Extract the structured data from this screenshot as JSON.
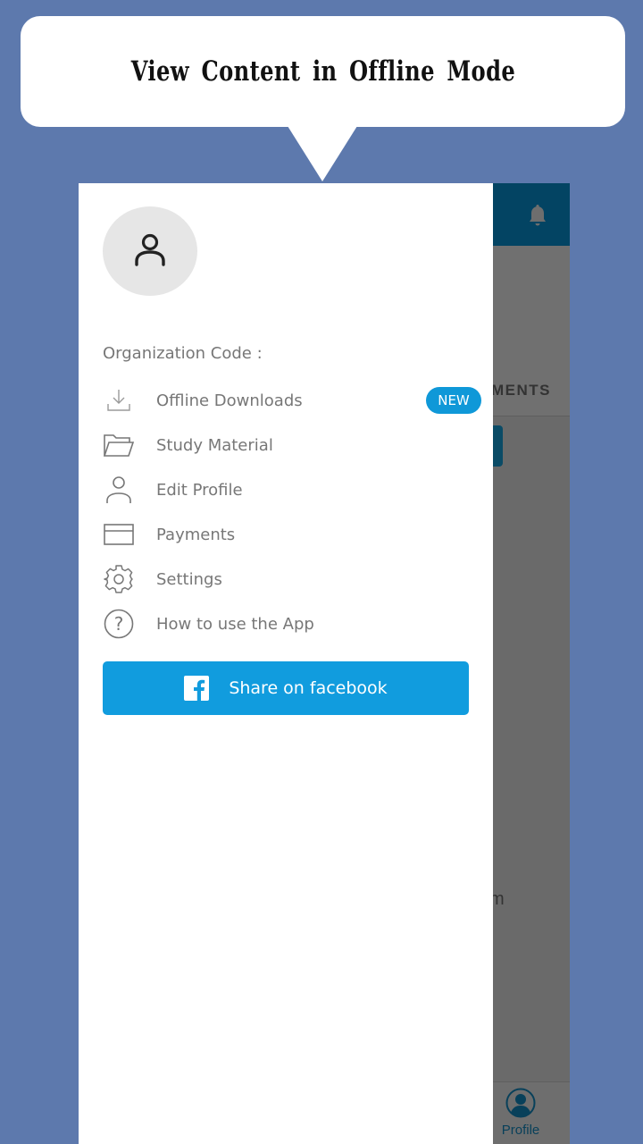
{
  "banner": {
    "title": "View Content in Offline Mode"
  },
  "background_app": {
    "tab_partial": "MENTS",
    "partial_text": "m",
    "bottom_nav": {
      "profile_label": "Profile"
    }
  },
  "drawer": {
    "organization_code_label": "Organization Code :",
    "menu": [
      {
        "icon": "download-icon",
        "label": "Offline Downloads",
        "badge": "NEW"
      },
      {
        "icon": "folder-icon",
        "label": "Study Material"
      },
      {
        "icon": "user-icon",
        "label": "Edit Profile"
      },
      {
        "icon": "card-icon",
        "label": "Payments"
      },
      {
        "icon": "gear-icon",
        "label": "Settings"
      },
      {
        "icon": "help-icon",
        "label": "How to use the App"
      }
    ],
    "share_button_label": "Share on facebook"
  },
  "colors": {
    "background": "#5d79ad",
    "header": "#034463",
    "accent": "#119cde",
    "badge": "#0f98d8"
  }
}
